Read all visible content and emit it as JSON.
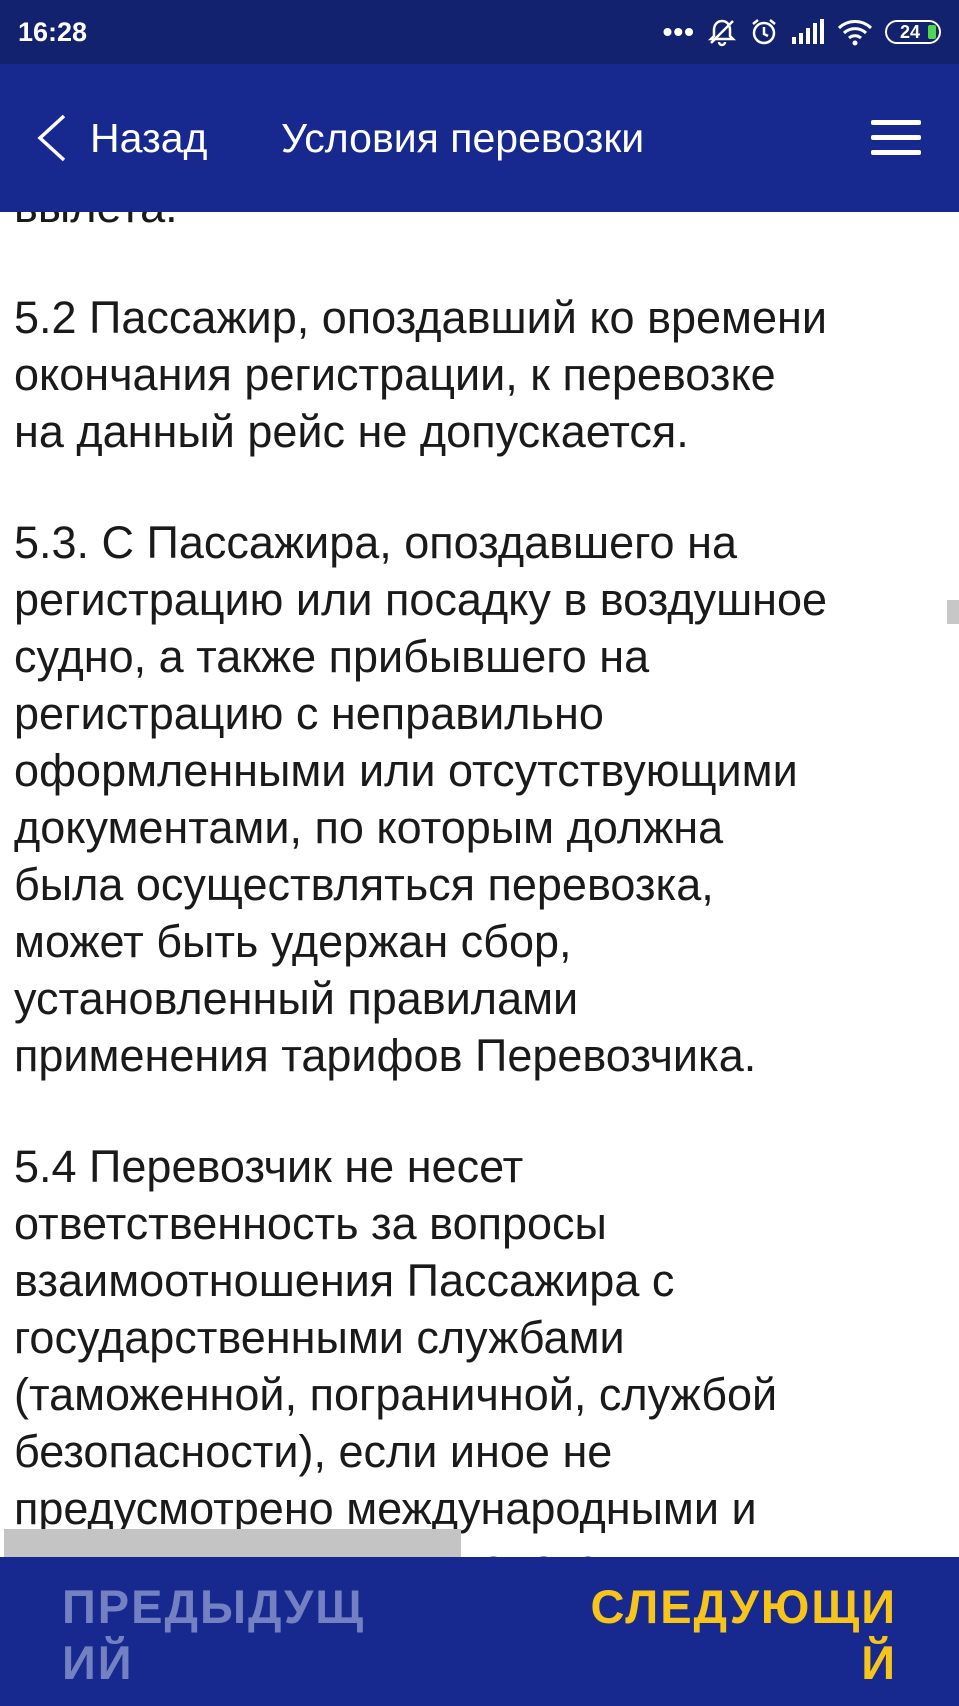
{
  "status_bar": {
    "time": "16:28",
    "battery": "24",
    "icons": [
      "more-dots-icon",
      "mute-bell-icon",
      "alarm-icon",
      "signal-icon",
      "wifi-icon",
      "battery-icon"
    ],
    "battery_color": "#4fd84f"
  },
  "app_bar": {
    "back_label": "Назад",
    "title": "Условия перевозки",
    "color": "#17298f"
  },
  "content": {
    "partial_top": "вылета.",
    "paragraphs": [
      "5.2 Пассажир, опоздавший ко времени\nокончания регистрации, к перевозке\nна данный рейс не допускается.",
      "5.3. С Пассажира, опоздавшего на\nрегистрацию или посадку в воздушное\nсудно, а также прибывшего на\nрегистрацию с неправильно\nоформленными или отсутствующими\nдокументами, по которым должна\nбыла осуществляться перевозка,\nможет быть удержан сбор,\nустановленный правилами\nприменения тарифов Перевозчика.",
      "5.4 Перевозчик не несет\nответственность за вопросы\nвзаимоотношения Пассажира с\nгосударственными службами\n(таможенной, пограничной, службой\nбезопасности), если иное не\nпредусмотрено международными и\nнациональными законодательными"
    ]
  },
  "bottom_bar": {
    "prev_label": "ПРЕДЫДУЩ\nИЙ",
    "next_label": "СЛЕДУЮЩИ\nЙ",
    "prev_color": "#7381c2",
    "next_color": "#f7c519"
  }
}
